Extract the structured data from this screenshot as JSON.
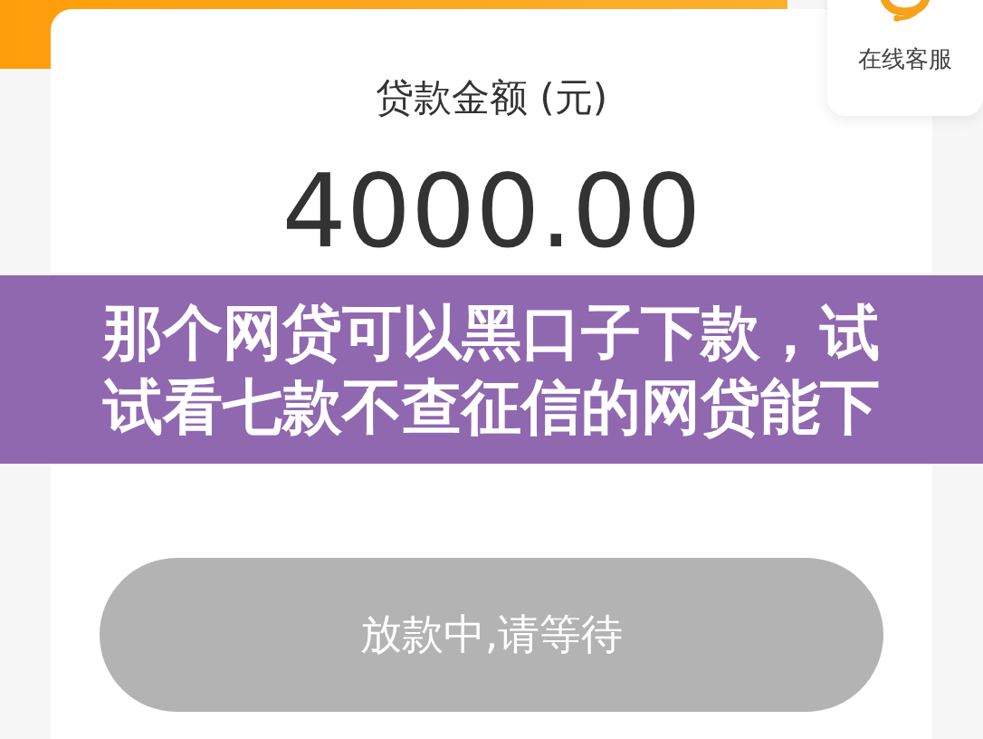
{
  "support": {
    "label": "在线客服"
  },
  "loan": {
    "label": "贷款金额 (元)",
    "amount": "4000.00"
  },
  "banner": {
    "title": "那个网贷可以黑口子下款，试试看七款不查征信的网贷能下"
  },
  "action_button": {
    "label": "放款中,请等待",
    "disabled": true
  }
}
